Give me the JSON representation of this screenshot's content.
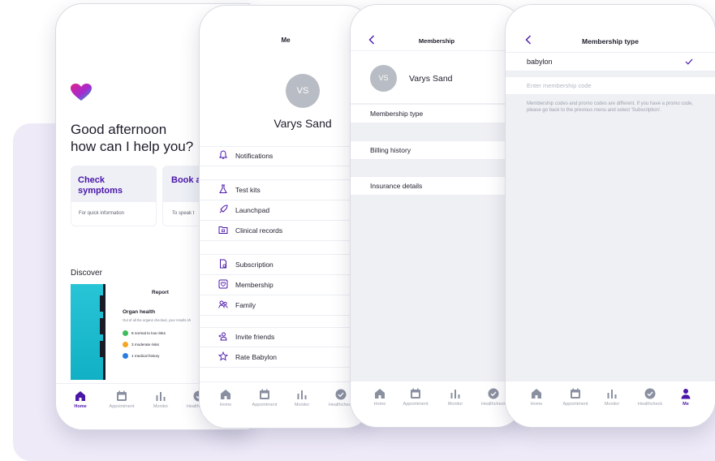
{
  "colors": {
    "accent": "#4a16a8",
    "avatar": "#b8bcc4",
    "card": "#eef0f6",
    "screen_bg": "#eff0f4",
    "panel": "#eeeaf8"
  },
  "tabs": [
    "Home",
    "Appointment",
    "Monitor",
    "Healthcheck",
    "Me"
  ],
  "home": {
    "greeting": "Good afternoon\nhow can I help you?",
    "cards": [
      {
        "title": "Check symptoms",
        "subtitle": "For quick information"
      },
      {
        "title": "Book appoin",
        "subtitle": "To speak t"
      }
    ],
    "discover": "Discover",
    "report": {
      "title": "Report",
      "subtitle": "Organ health",
      "desc": "Out of all the organs checked, your results sh",
      "items": [
        "8 normal to low risks",
        "3 moderate risks",
        "1 medical history"
      ]
    }
  },
  "me": {
    "title": "Me",
    "initials": "VS",
    "name": "Varys Sand",
    "items": [
      "Notifications",
      "Test kits",
      "Launchpad",
      "Clinical records",
      "Subscription",
      "Membership",
      "Family",
      "Invite friends",
      "Rate Babylon"
    ]
  },
  "membership": {
    "title": "Membership",
    "initials": "VS",
    "name": "Varys Sand",
    "items": [
      "Membership type",
      "Billing history",
      "Insurance details"
    ]
  },
  "membership_type": {
    "title": "Membership type",
    "selected": "babylon",
    "code_placeholder": "Enter membership code",
    "note": "Membership codes and promo codes are different. If you have a promo code, please go back to the previous menu and select 'Subscription'."
  }
}
